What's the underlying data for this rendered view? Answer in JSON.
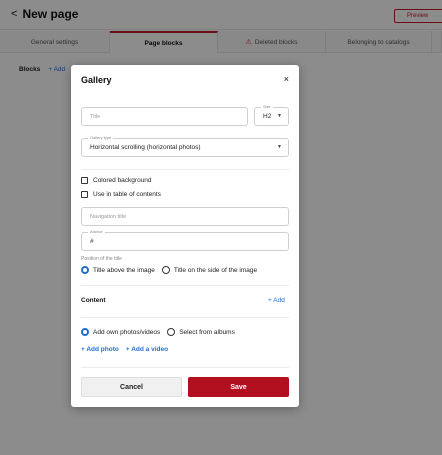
{
  "page": {
    "title": "New page",
    "preview_label": "Preview",
    "tabs": [
      {
        "label": "General settings"
      },
      {
        "label": "Page blocks"
      },
      {
        "label": "Deleted blocks"
      },
      {
        "label": "Belonging to catalogs"
      }
    ],
    "blocks_label": "Blocks",
    "add_label": "+ Add"
  },
  "modal": {
    "title": "Gallery",
    "close_symbol": "×",
    "title_input": {
      "placeholder": "Title"
    },
    "size": {
      "label": "Size",
      "value": "H2"
    },
    "gallery_type": {
      "label": "Gallery type",
      "value": "Horizontal scrolling (horizontal photos)"
    },
    "colored_background_label": "Colored background",
    "toc_label": "Use in table of contents",
    "navigation_title": {
      "placeholder": "Navigation title"
    },
    "anchor": {
      "label": "Anchor",
      "value": "#"
    },
    "title_position": {
      "label": "Position of the title",
      "option_above": "Title above the image",
      "option_side": "Title on the side of the image",
      "selected": "above"
    },
    "content": {
      "title": "Content",
      "add_label": "+ Add",
      "source_own": "Add own photos/videos",
      "source_albums": "Select from albums",
      "selected_source": "own",
      "add_photo": "+ Add photo",
      "add_video": "+ Add a video"
    },
    "cancel_label": "Cancel",
    "save_label": "Save"
  },
  "colors": {
    "accent_red": "#b2101f",
    "link_blue": "#1f6fd1"
  }
}
